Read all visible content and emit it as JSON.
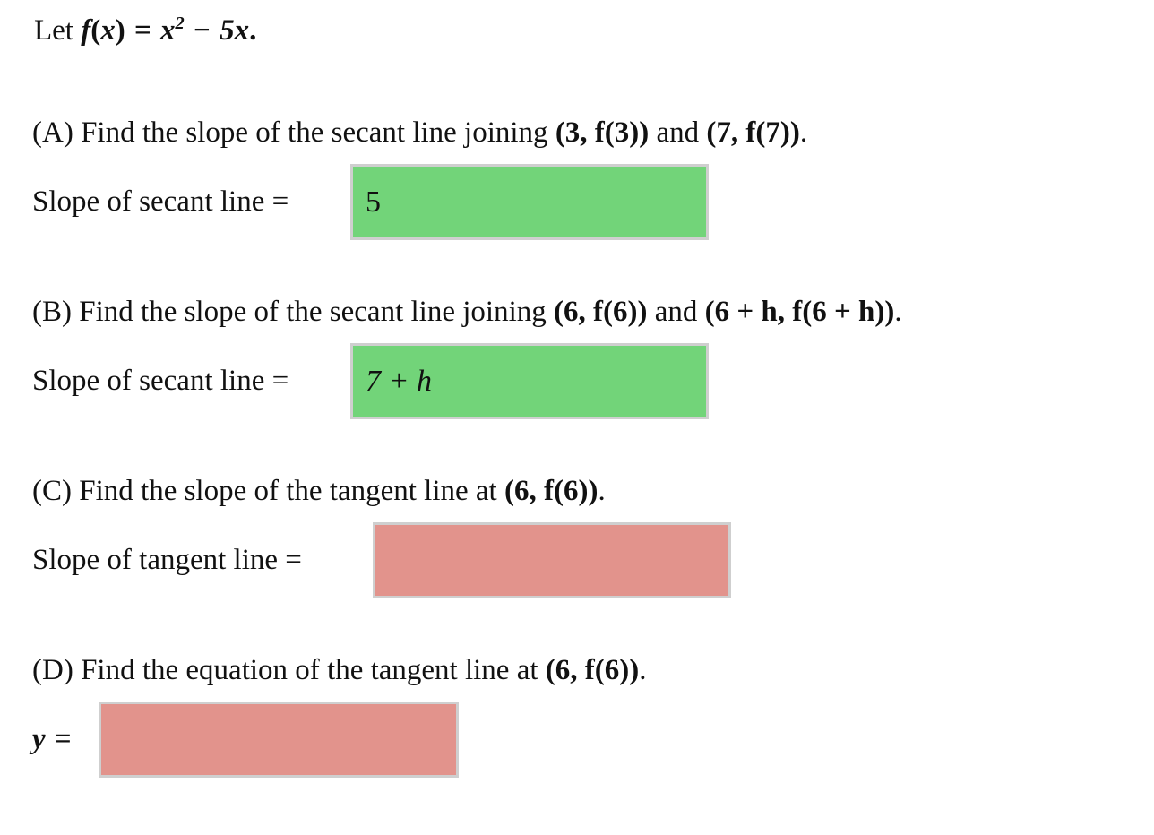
{
  "problem": {
    "preamble": {
      "lead": "Let",
      "function_name": "f",
      "open": "(",
      "variable": "x",
      "close": ")",
      "equals": "=",
      "term1_base": "x",
      "term1_exponent": "2",
      "minus": "−",
      "term2": "5x",
      "period": "."
    },
    "parts": [
      {
        "id": "A",
        "label": "(A)",
        "question_pre": "Find the slope of the secant line joining",
        "point1": "(3, f(3))",
        "conjunction": "and",
        "point2": "(7, f(7))",
        "question_post": ".",
        "answer_label": "Slope of secant line",
        "equals": "=",
        "answer_value": "5",
        "status": "correct",
        "status_color": "#72d479"
      },
      {
        "id": "B",
        "label": "(B)",
        "question_pre": "Find the slope of the secant line joining",
        "point1": "(6, f(6))",
        "conjunction": "and",
        "point2": "(6 + h, f(6 + h))",
        "question_post": ".",
        "answer_label": "Slope of secant line",
        "equals": "=",
        "answer_value": "7 + h",
        "status": "correct",
        "status_color": "#72d479"
      },
      {
        "id": "C",
        "label": "(C)",
        "question_pre": "Find the slope of the tangent line at",
        "point1": "(6, f(6))",
        "conjunction": "",
        "point2": "",
        "question_post": ".",
        "answer_label": "Slope of tangent line",
        "equals": "=",
        "answer_value": "",
        "status": "incorrect",
        "status_color": "#e2938c"
      },
      {
        "id": "D",
        "label": "(D)",
        "question_pre": "Find the equation of the tangent line at",
        "point1": "(6, f(6))",
        "conjunction": "",
        "point2": "",
        "question_post": ".",
        "answer_label": "y",
        "equals": "=",
        "answer_value": "",
        "status": "incorrect",
        "status_color": "#e2938c"
      }
    ]
  },
  "theme": {
    "background": "#ffffff",
    "text_color": "#111111",
    "box_border": "#cfcfcf",
    "correct_fill": "#72d479",
    "incorrect_fill": "#e2938c"
  }
}
